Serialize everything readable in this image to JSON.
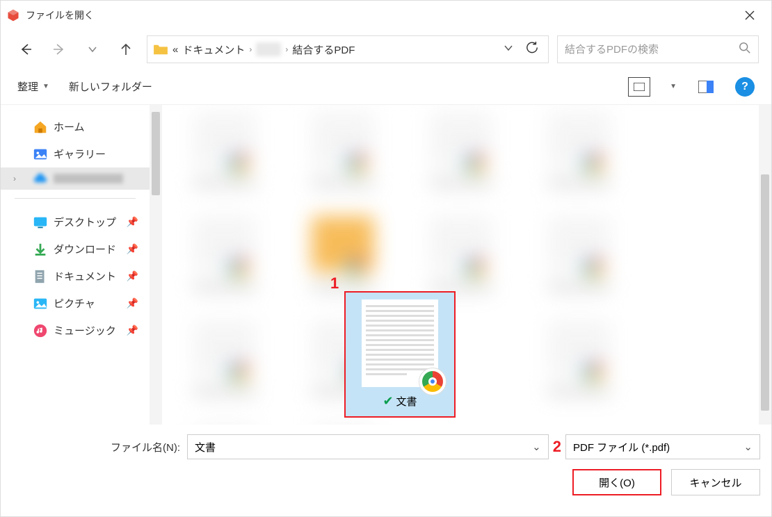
{
  "window": {
    "title": "ファイルを開く"
  },
  "breadcrumb": {
    "more": "«",
    "seg1": "ドキュメント",
    "seg2": "結合するPDF"
  },
  "search": {
    "placeholder": "結合するPDFの検索"
  },
  "toolbar": {
    "organize": "整理",
    "new_folder": "新しいフォルダー",
    "help": "?"
  },
  "sidebar": {
    "home": "ホーム",
    "gallery": "ギャラリー",
    "desktop": "デスクトップ",
    "downloads": "ダウンロード",
    "documents": "ドキュメント",
    "pictures": "ピクチャ",
    "music": "ミュージック"
  },
  "file": {
    "selected_name": "文書"
  },
  "footer": {
    "filename_label": "ファイル名(N):",
    "filename_value": "文書",
    "filetype_value": "PDF ファイル (*.pdf)",
    "open": "開く(O)",
    "cancel": "キャンセル"
  },
  "annotations": {
    "one": "1",
    "two": "2"
  }
}
